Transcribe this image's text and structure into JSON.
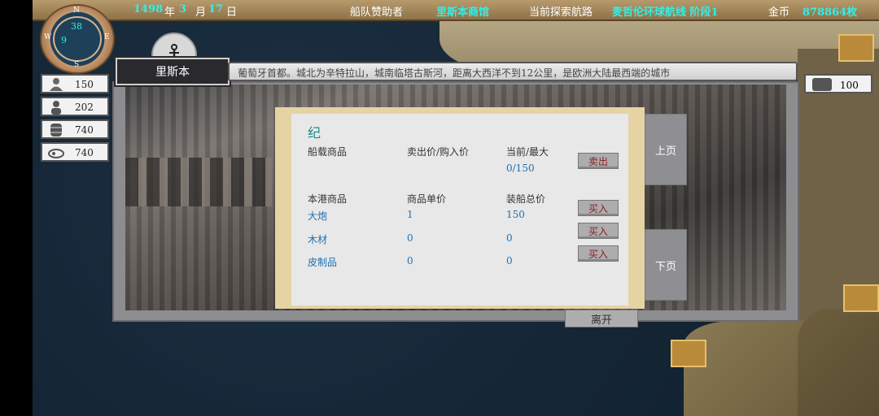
{
  "topbar": {
    "year": "1498",
    "year_unit": "年",
    "month": "3",
    "month_unit": "月",
    "day": "17",
    "day_unit": "日",
    "sponsor_label": "船队赞助者",
    "sponsor_value": "里斯本商馆",
    "route_label": "当前探索航路",
    "route_value": "麦哲伦环球航线 阶段1",
    "gold_label": "金币",
    "gold_value": "878864枚"
  },
  "compass": {
    "n": "N",
    "s": "S",
    "e": "E",
    "w": "W",
    "top_value": "38",
    "left_value": "9"
  },
  "port": {
    "name": "里斯本",
    "description": "葡萄牙首都。城北为辛特拉山，城南临塔古斯河，距离大西洋不到12公里，是欧洲大陆最西端的城市"
  },
  "stats": [
    {
      "icon": "sailor-icon",
      "value": "150"
    },
    {
      "icon": "person-icon",
      "value": "202"
    },
    {
      "icon": "barrel-icon",
      "value": "740"
    },
    {
      "icon": "food-icon",
      "value": "740"
    }
  ],
  "messages": {
    "count": "100"
  },
  "trade": {
    "title": "纪",
    "ship_header": {
      "goods": "船载商品",
      "price": "卖出价/购入价",
      "qty": "当前/最大"
    },
    "ship_qty": "0/150",
    "sell_label": "卖出",
    "port_header": {
      "goods": "本港商品",
      "price": "商品单价",
      "total": "装船总价"
    },
    "buy_label": "买入",
    "port_goods": [
      {
        "name": "大炮",
        "price": "1",
        "total": "150"
      },
      {
        "name": "木材",
        "price": "0",
        "total": "0"
      },
      {
        "name": "皮制品",
        "price": "0",
        "total": "0"
      }
    ]
  },
  "nav": {
    "prev": "上页",
    "next": "下页",
    "leave": "离开"
  }
}
